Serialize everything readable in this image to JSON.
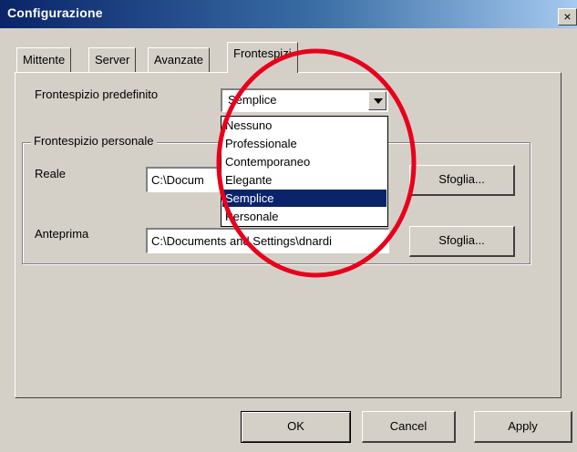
{
  "window": {
    "title": "Configurazione",
    "close_glyph": "×"
  },
  "tabs": [
    {
      "label": "Mittente",
      "active": false
    },
    {
      "label": "Server",
      "active": false
    },
    {
      "label": "Avanzate",
      "active": false
    },
    {
      "label": "Frontespizi",
      "active": true
    }
  ],
  "default_cover": {
    "label": "Frontespizio predefinito",
    "selected_value": "Semplice",
    "options": [
      "Nessuno",
      "Professionale",
      "Contemporaneo",
      "Elegante",
      "Semplice",
      "Personale"
    ],
    "selected_index": 4
  },
  "custom_cover": {
    "group_label": "Frontespizio personale",
    "reale_label": "Reale",
    "reale_value": "C:\\Docum",
    "anteprima_label": "Anteprima",
    "anteprima_value": "C:\\Documents and Settings\\dnardi",
    "browse_label": "Sfoglia..."
  },
  "buttons": {
    "ok": "OK",
    "cancel": "Cancel",
    "apply": "Apply"
  },
  "colors": {
    "selection": "#0a246a",
    "annotation": "#e8001c",
    "dialog_bg": "#d4d0c8"
  }
}
